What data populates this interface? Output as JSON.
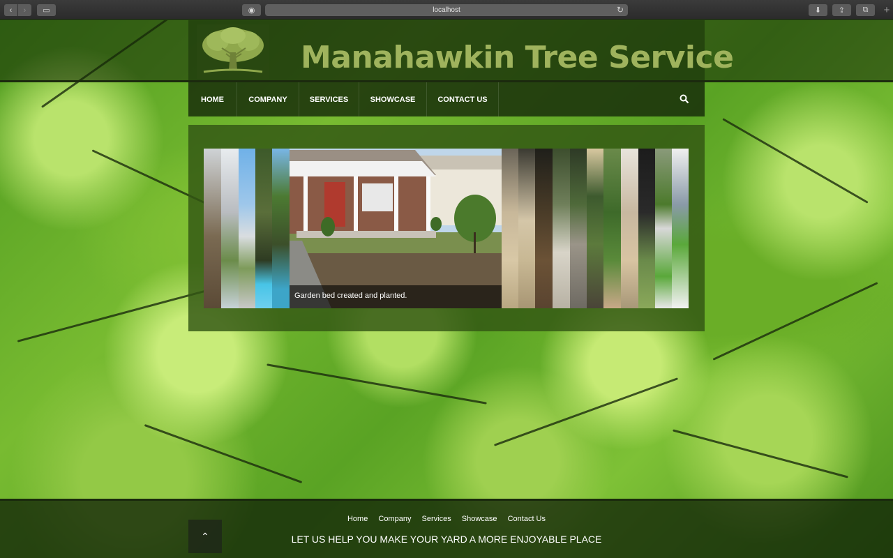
{
  "browser": {
    "url": "localhost",
    "back_glyph": "‹",
    "forward_glyph": "›",
    "sidebar_glyph": "▭",
    "reader_glyph": "◉",
    "reload_glyph": "↻",
    "download_glyph": "⬇",
    "share_glyph": "⇪",
    "tabs_glyph": "⧉",
    "new_tab_glyph": "+"
  },
  "header": {
    "title": "Manahawkin Tree Service",
    "title_color": "#9fb35d",
    "logo_icon": "tree-logo"
  },
  "nav": {
    "items": [
      {
        "label": "HOME"
      },
      {
        "label": "COMPANY"
      },
      {
        "label": "SERVICES"
      },
      {
        "label": "SHOWCASE"
      },
      {
        "label": "CONTACT US"
      }
    ],
    "search_icon": "search-icon"
  },
  "slider": {
    "caption": "Garden bed created and planted."
  },
  "footer": {
    "links": [
      "Home",
      "Company",
      "Services",
      "Showcase",
      "Contact Us"
    ],
    "tagline": "LET US HELP YOU MAKE YOUR YARD A MORE ENJOYABLE PLACE",
    "to_top_glyph": "⌃"
  }
}
